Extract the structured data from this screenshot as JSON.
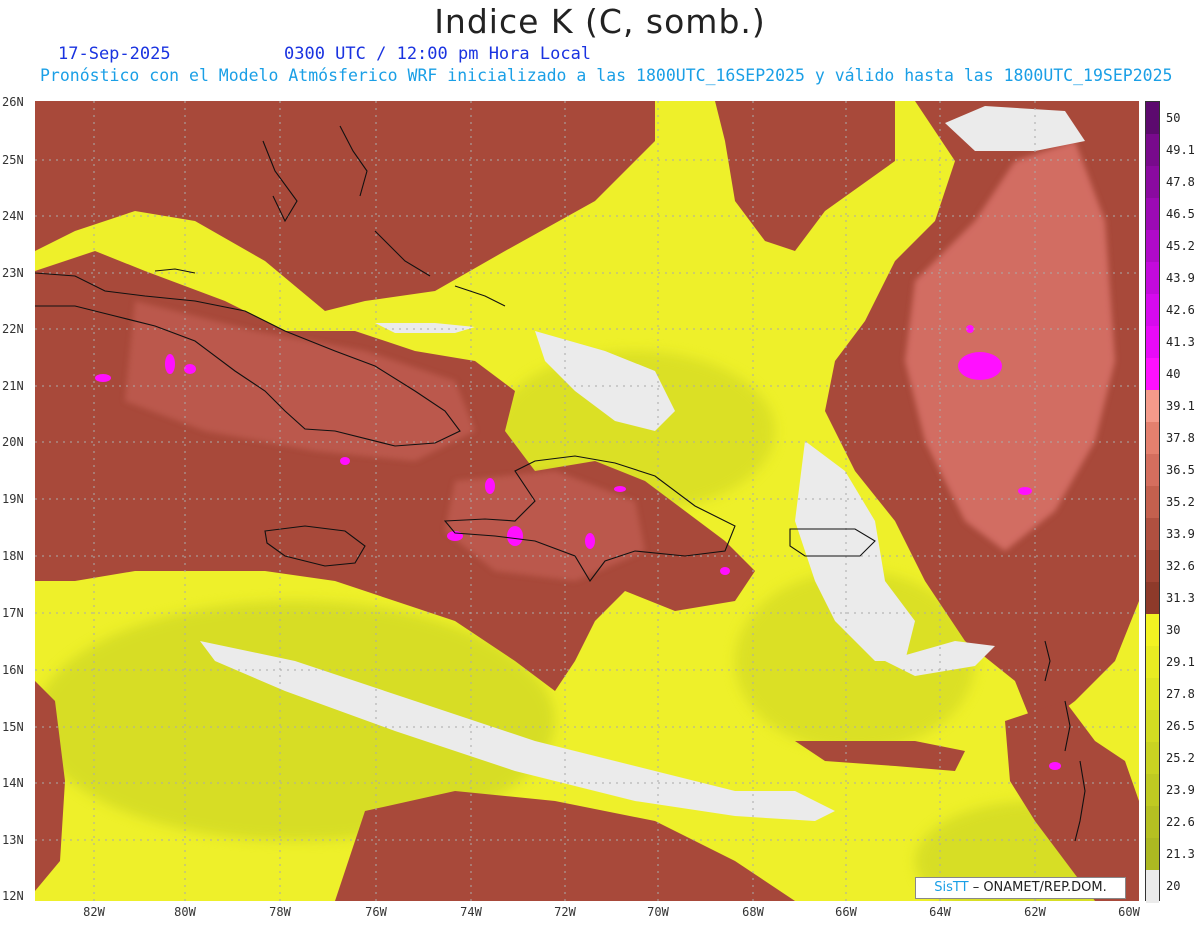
{
  "header": {
    "title": "Indice K (C, somb.)",
    "date": "17-Sep-2025",
    "time": "0300 UTC / 12:00 pm Hora Local",
    "subtitle": "Pronóstico con el Modelo Atmósferico WRF inicializado a las 1800UTC_16SEP2025 y válido hasta las  1800UTC_19SEP2025"
  },
  "map": {
    "lat_labels": [
      "26N",
      "25N",
      "24N",
      "23N",
      "22N",
      "21N",
      "20N",
      "19N",
      "18N",
      "17N",
      "16N",
      "15N",
      "14N",
      "13N",
      "12N"
    ],
    "lon_labels": [
      "82W",
      "80W",
      "78W",
      "76W",
      "74W",
      "72W",
      "70W",
      "68W",
      "66W",
      "64W",
      "62W",
      "60W"
    ],
    "credit_brand": "SisTT",
    "credit_text": " – ONAMET/REP.DOM."
  },
  "colorbar": {
    "labels": [
      "50",
      "49.1",
      "47.8",
      "46.5",
      "45.2",
      "43.9",
      "42.6",
      "41.3",
      "40",
      "39.1",
      "37.8",
      "36.5",
      "35.2",
      "33.9",
      "32.6",
      "31.3",
      "30",
      "29.1",
      "27.8",
      "26.5",
      "25.2",
      "23.9",
      "22.6",
      "21.3",
      "20"
    ],
    "colors": [
      "#5c0a6e",
      "#780a8c",
      "#8a0aa0",
      "#9c0ab4",
      "#b00ac8",
      "#c30adc",
      "#d60aee",
      "#e80af8",
      "#ff10ff",
      "#f49a8a",
      "#e4806e",
      "#d46e5e",
      "#c4604e",
      "#b05040",
      "#a04434",
      "#8e3a2a",
      "#f3f322",
      "#e9ec22",
      "#dfe522",
      "#d3dc22",
      "#c9d322",
      "#bfca22",
      "#b5c022",
      "#acb822",
      "#ebebeb"
    ]
  }
}
